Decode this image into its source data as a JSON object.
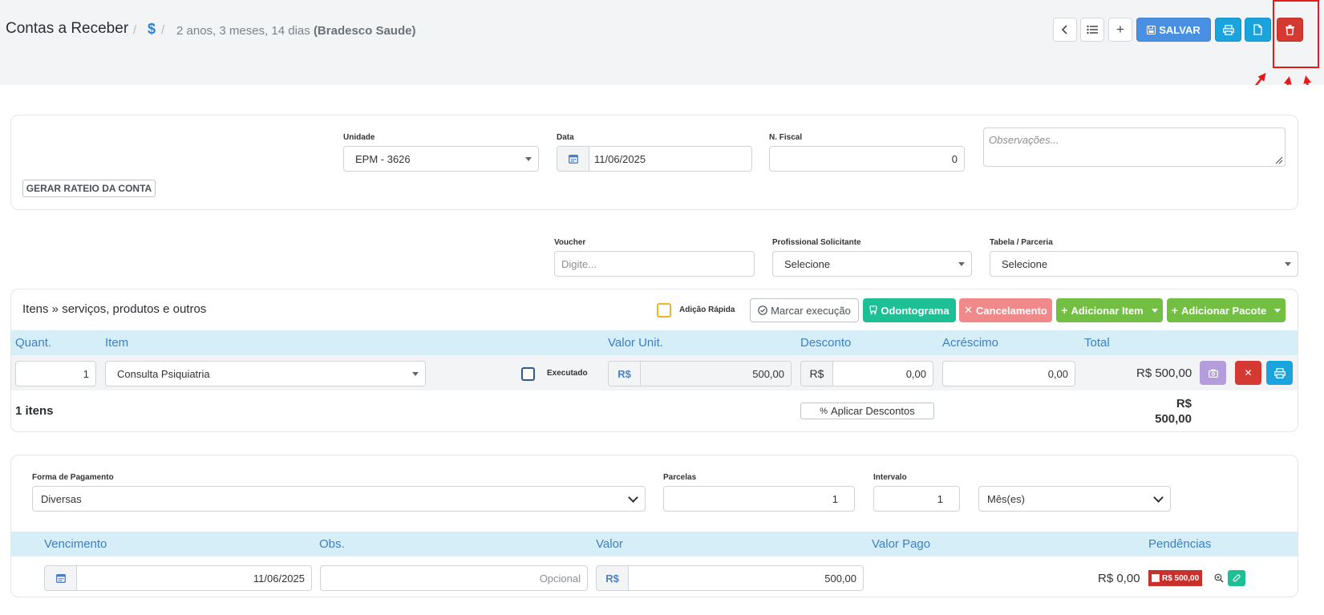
{
  "header": {
    "title": "Contas a Receber",
    "breadcrumb_sep": "/",
    "breadcrumb_dollar": "$",
    "breadcrumb_age": "2 anos, 3 meses, 14 dias",
    "breadcrumb_patient": "(Bradesco Saude)",
    "toolbar": {
      "back_icon": "chevron-left",
      "list_icon": "list",
      "add_icon": "+",
      "save_label": "SALVAR",
      "print_icon": "printer",
      "file_icon": "file",
      "delete_icon": "trash"
    }
  },
  "form1": {
    "rateio_label": "GERAR RATEIO DA CONTA",
    "unidade_label": "Unidade",
    "unidade_value": "EPM - 3626",
    "data_label": "Data",
    "data_value": "11/06/2025",
    "nfiscal_label": "N. Fiscal",
    "nfiscal_value": "0",
    "obs_placeholder": "Observações..."
  },
  "form2": {
    "voucher_label": "Voucher",
    "voucher_placeholder": "Digite...",
    "prof_label": "Profissional Solicitante",
    "prof_value": "Selecione",
    "tabela_label": "Tabela / Parceria",
    "tabela_value": "Selecione"
  },
  "items": {
    "title": "Itens » serviços, produtos e outros",
    "quick_add_label": "Adição Rápida",
    "marcar_label": "Marcar execução",
    "odonto_label": "Odontograma",
    "cancel_label": "Cancelamento",
    "add_item_label": "Adicionar Item",
    "add_pacote_label": "Adicionar Pacote",
    "columns": [
      "Quant.",
      "Item",
      "Valor Unit.",
      "Desconto",
      "Acréscimo",
      "Total"
    ],
    "row": {
      "qty": "1",
      "item": "Consulta Psiquiatria",
      "executado_label": "Executado",
      "currency": "R$",
      "unit_value": "500,00",
      "discount_currency": "R$",
      "discount": "0,00",
      "increase": "0,00",
      "total": "R$ 500,00"
    },
    "footer": {
      "count_label": "1 itens",
      "apply_discount_label": "Aplicar Descontos",
      "sum_currency": "R$",
      "sum_value": "500,00"
    }
  },
  "payment": {
    "forma_label": "Forma de Pagamento",
    "forma_value": "Diversas",
    "parcelas_label": "Parcelas",
    "parcelas_value": "1",
    "intervalo_label": "Intervalo",
    "intervalo_value": "1",
    "periodo_value": "Mês(es)",
    "columns": [
      "Vencimento",
      "Obs.",
      "Valor",
      "Valor Pago",
      "Pendências"
    ],
    "row": {
      "vencimento": "11/06/2025",
      "obs_placeholder": "Opcional",
      "currency": "R$",
      "valor": "500,00",
      "valor_pago": "R$ 0,00",
      "pendencia": "R$ 500,00"
    }
  },
  "colors": {
    "save": "#4a90e2",
    "cyan": "#1aa3dd",
    "danger": "#d43a32",
    "green": "#72bf44",
    "teal": "#1ebf95",
    "pink": "#f08a8a",
    "purple": "#b39ddb",
    "table_header": "#d6eef8",
    "annotation": "#e51a1a"
  }
}
